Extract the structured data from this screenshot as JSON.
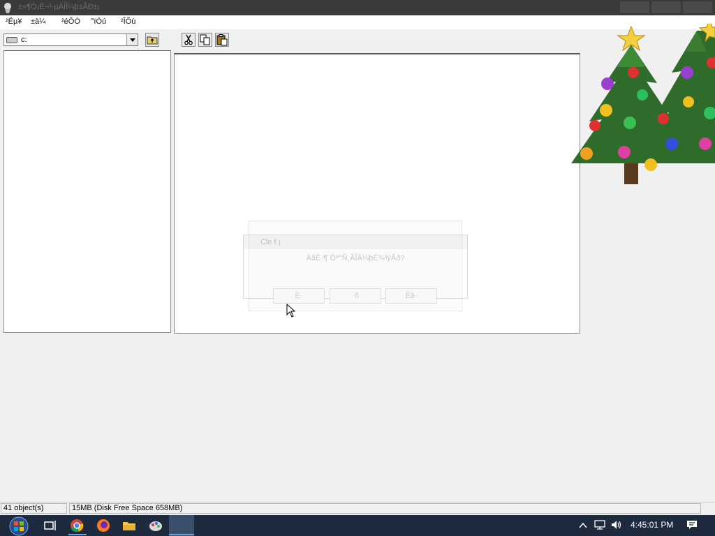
{
  "window": {
    "title": "±»¶Ó¡É¬³·µÄÌÎ¼þ±ÃÐ±¡"
  },
  "menu": {
    "items": [
      "²Ëµ¥",
      "±à¼­",
      "²éÕÒ",
      "°ïÖú",
      "²ÎÕú"
    ]
  },
  "toolbar": {
    "drive_value": "c:"
  },
  "dialog": {
    "title": "Cle f ¡",
    "message": "ÄãÈ·¶¨Òª°Ñ¸ÃÎÄ¼þÉ¾³ýÂð?",
    "buttons": [
      "È·",
      "·ñ",
      "Ëã·"
    ]
  },
  "statusbar": {
    "objects": "41 object(s)",
    "space": "15MB (Disk Free Space 658MB)"
  },
  "taskbar": {
    "time": "4:45:01 PM"
  }
}
